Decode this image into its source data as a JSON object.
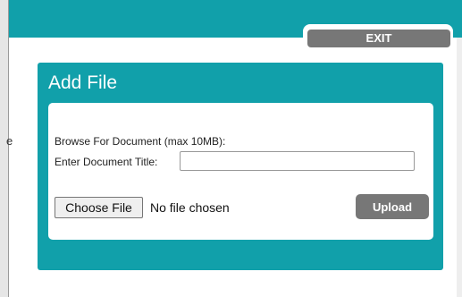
{
  "window": {
    "exit_label": "EXIT",
    "left_edge_char": "e"
  },
  "dialog": {
    "title": "Add File",
    "browse_label": "Browse For Document (max 10MB):",
    "title_label": "Enter Document Title:",
    "title_value": "",
    "choose_file_label": "Choose File",
    "file_status": "No file chosen",
    "upload_label": "Upload"
  },
  "colors": {
    "accent_teal": "#11a0aa",
    "button_gray": "#777777"
  },
  "icons": []
}
